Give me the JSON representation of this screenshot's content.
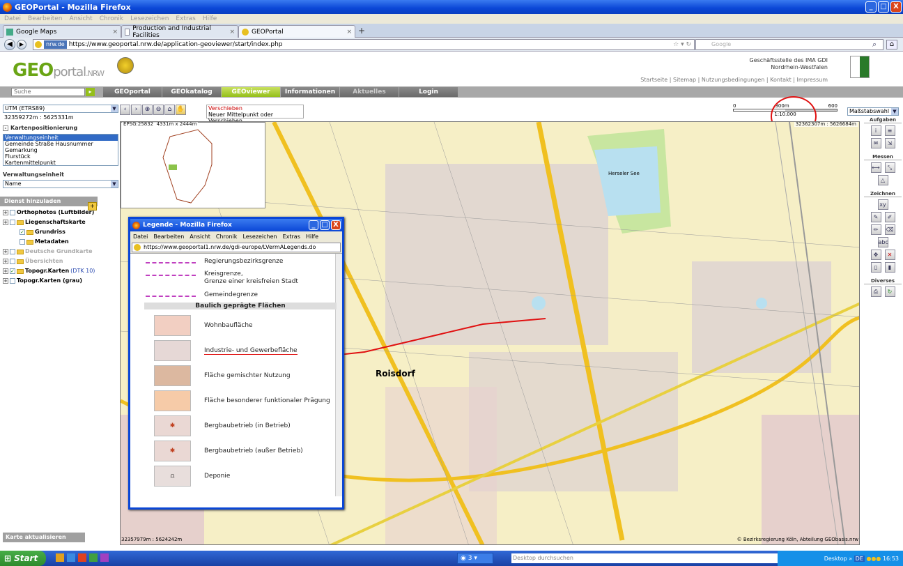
{
  "window": {
    "title": "GEOPortal - Mozilla Firefox",
    "btns": [
      "_",
      "□",
      "X"
    ]
  },
  "menu": [
    "Datei",
    "Bearbeiten",
    "Ansicht",
    "Chronik",
    "Lesezeichen",
    "Extras",
    "Hilfe"
  ],
  "tabs": [
    {
      "label": "Google Maps",
      "close": "×"
    },
    {
      "label": "Production and Industrial Facilities",
      "close": "×"
    },
    {
      "label": "GEOPortal",
      "close": "×"
    }
  ],
  "newtab": "+",
  "nav": {
    "site_badge": "nrw.de",
    "url": "https://www.geoportal.nrw.de/application-geoviewer/start/index.php",
    "search_placeholder": "Google"
  },
  "header": {
    "logo_geo": "GEO",
    "logo_portal": "portal",
    "logo_suffix": ".NRW",
    "org_line1": "Geschäftsstelle des IMA GDI",
    "org_line2": "Nordrhein-Westfalen",
    "links": "Startseite | Sitemap | Nutzungsbedingungen | Kontakt | Impressum"
  },
  "mainnav": {
    "search_placeholder": "Suche",
    "search_go": "▸",
    "items": [
      {
        "label": "GEOportal",
        "state": "normal"
      },
      {
        "label": "GEOkatalog",
        "state": "normal"
      },
      {
        "label": "GEOviewer",
        "state": "active"
      },
      {
        "label": "Informationen",
        "state": "normal"
      },
      {
        "label": "Aktuelles",
        "state": "dim"
      },
      {
        "label": "Login",
        "state": "normal"
      }
    ]
  },
  "left": {
    "crs": "UTM (ETRS89)",
    "coords": "32359272m : 5625331m",
    "kartenpos_title": "Kartenpositionierung",
    "kartenpos_items": [
      "Verwaltungseinheit",
      "Gemeinde Straße Hausnummer",
      "Gemarkung",
      "Flurstück",
      "Kartenmittelpunkt"
    ],
    "verwaltung_title": "Verwaltungseinheit",
    "verwaltung_select": "Name",
    "dienst_title": "Dienst hinzuladen",
    "tree": [
      {
        "label": "Orthophotos (Luftbilder)",
        "level": 0,
        "checked": false,
        "folder": false,
        "gray": false
      },
      {
        "label": "Liegenschaftskarte",
        "level": 0,
        "checked": false,
        "folder": true,
        "gray": false
      },
      {
        "label": "Grundriss",
        "level": 1,
        "checked": true,
        "folder": true,
        "gray": false
      },
      {
        "label": "Metadaten",
        "level": 1,
        "checked": false,
        "folder": true,
        "gray": false
      },
      {
        "label": "Deutsche Grundkarte",
        "level": 0,
        "checked": false,
        "folder": true,
        "gray": true
      },
      {
        "label": "Übersichten",
        "level": 0,
        "checked": false,
        "folder": true,
        "gray": true
      },
      {
        "label": "Topogr.Karten",
        "suffix": "(DTK 10)",
        "level": 0,
        "checked": true,
        "folder": true,
        "gray": false
      },
      {
        "label": "Topogr.Karten (grau)",
        "level": 0,
        "checked": false,
        "folder": false,
        "gray": false
      }
    ],
    "refresh": "Karte aktualisieren"
  },
  "tools": {
    "hint_title": "Verschieben",
    "hint_text": "Neuer Mittelpunkt oder Verschieben"
  },
  "scale": {
    "s0": "0",
    "s1": "300m",
    "s2": "600",
    "ratio": "1:10.000",
    "select": "Maßstabswahl"
  },
  "map": {
    "epsg": "EPSG:25832",
    "extent": "4331m x 2444m",
    "coord_tr": "32362307m : 5626684m",
    "coord_bl": "32357979m : 5624242m",
    "copyright": "© Bezirksregierung Köln, Abteilung GEObasis.nrw",
    "label_town": "Roisdorf",
    "label_lake": "Herseler See"
  },
  "right": {
    "aufgaben": "Aufgaben",
    "messen": "Messen",
    "zeichnen": "Zeichnen",
    "diverses": "Diverses",
    "xy": "xy",
    "abc": "abc"
  },
  "popup": {
    "title": "Legende - Mozilla Firefox",
    "menu": [
      "Datei",
      "Bearbeiten",
      "Ansicht",
      "Chronik",
      "Lesezeichen",
      "Extras",
      "Hilfe"
    ],
    "url": "https://www.geoportal1.nrw.de/gdi-europe/LVermALegends.do",
    "lines": [
      {
        "label": "Regierungsbezirksgrenze"
      },
      {
        "label": "Kreisgrenze,\nGrenze einer kreisfreien Stadt"
      },
      {
        "label": "Gemeindegrenze"
      }
    ],
    "section": "Baulich geprägte Flächen",
    "areas": [
      {
        "label": "Wohnbaufläche",
        "color": "#f2cfc2"
      },
      {
        "label": "Industrie- und Gewerbefläche",
        "color": "#e6d8d6"
      },
      {
        "label": "Fläche gemischter Nutzung",
        "color": "#dcb8a0"
      },
      {
        "label": "Fläche besonderer funktionaler Prägung",
        "color": "#f6cba8"
      },
      {
        "label": "Bergbaubetrieb (in Betrieb)",
        "color": "#ead8d4",
        "sym": "✱"
      },
      {
        "label": "Bergbaubetrieb (außer Betrieb)",
        "color": "#ead8d4",
        "sym": "✱"
      },
      {
        "label": "Deponie",
        "color": "#e8dedc",
        "sym": "⩍"
      }
    ]
  },
  "taskbar": {
    "start": "Start",
    "ff_count": "3",
    "desk_search": "Desktop durchsuchen",
    "desktop": "Desktop",
    "lang": "DE",
    "time": "16:53"
  }
}
